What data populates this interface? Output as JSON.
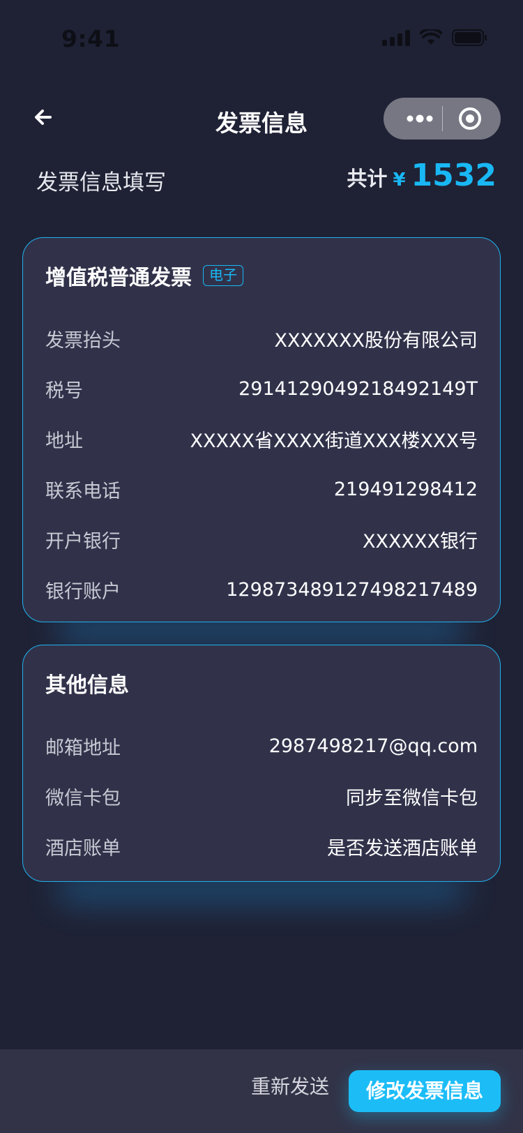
{
  "status_bar": {
    "time": "9:41"
  },
  "nav": {
    "title": "发票信息"
  },
  "summary": {
    "title": "发票信息填写",
    "total_label": "共计",
    "currency": "¥",
    "amount": "1532"
  },
  "invoice_card": {
    "title": "增值税普通发票",
    "tag": "电子",
    "rows": [
      {
        "label": "发票抬头",
        "value": "XXXXXXX股份有限公司"
      },
      {
        "label": "税号",
        "value": "291412904921849214 9T"
      },
      {
        "label": "地址",
        "value": "XXXXX省XXXX街道XXX楼XXX号"
      },
      {
        "label": "联系电话",
        "value": "219491298412"
      },
      {
        "label": "开户银行",
        "value": "XXXXXX银行"
      },
      {
        "label": "银行账户",
        "value": "129873489127498217489"
      }
    ]
  },
  "other_card": {
    "title": "其他信息",
    "rows": [
      {
        "label": "邮箱地址",
        "value": "2987498217@qq.com"
      },
      {
        "label": "微信卡包",
        "value": "同步至微信卡包"
      },
      {
        "label": "酒店账单",
        "value": "是否发送酒店账单"
      }
    ]
  },
  "bottom_bar": {
    "resend_label": "重新发送",
    "primary_label": "修改发票信息"
  },
  "colors": {
    "background": "#1f2235",
    "card": "#31324a",
    "accent": "#19b8f5"
  },
  "icons": [
    "signal-icon",
    "wifi-icon",
    "battery-icon",
    "back-arrow-icon",
    "more-dots-icon",
    "close-target-icon"
  ]
}
